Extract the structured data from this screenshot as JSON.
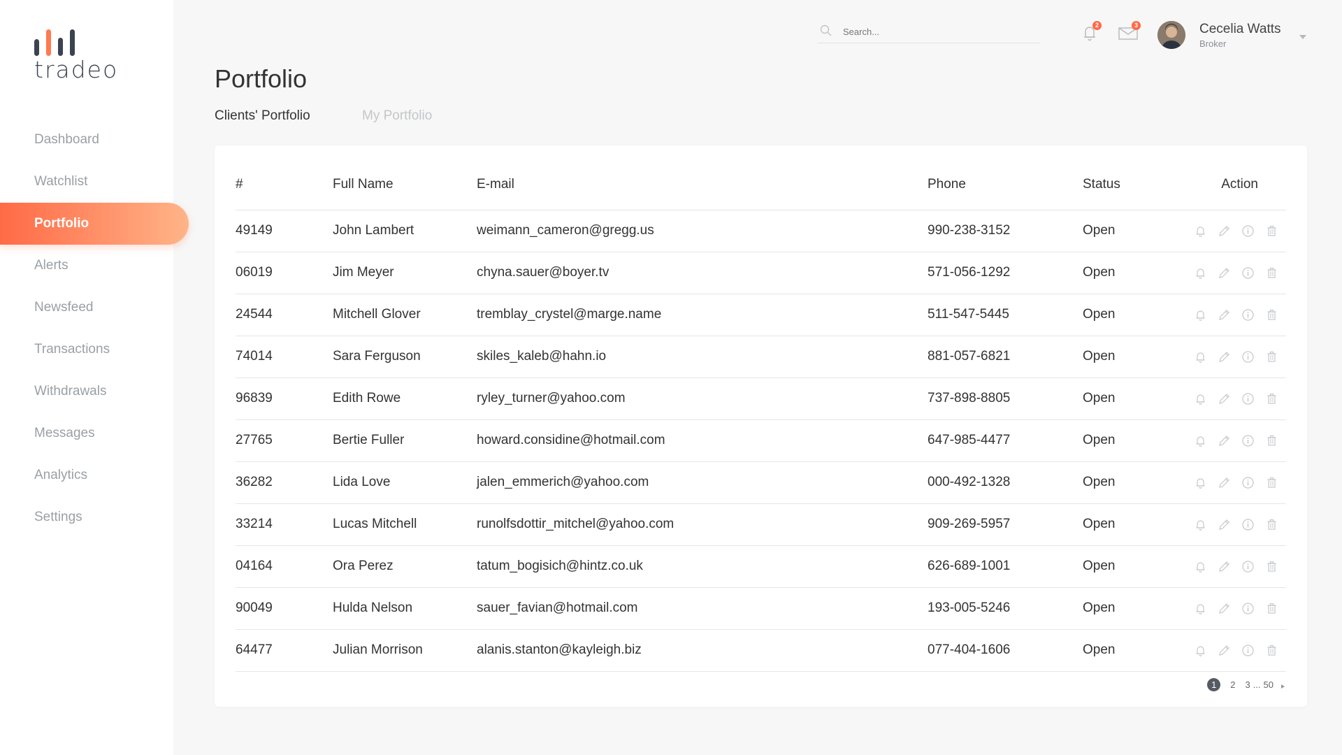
{
  "app": {
    "logo_text": "tradeo"
  },
  "colors": {
    "accent_start": "#ff6a46",
    "accent_end": "#ffb488",
    "status_open": "#7ed321"
  },
  "sidebar": {
    "items": [
      {
        "label": "Dashboard"
      },
      {
        "label": "Watchlist"
      },
      {
        "label": "Portfolio",
        "active": true
      },
      {
        "label": "Alerts"
      },
      {
        "label": "Newsfeed"
      },
      {
        "label": "Transactions"
      },
      {
        "label": "Withdrawals"
      },
      {
        "label": "Messages"
      },
      {
        "label": "Analytics"
      },
      {
        "label": "Settings"
      }
    ]
  },
  "header": {
    "search": {
      "placeholder": "Search..."
    },
    "notifications": {
      "icon": "bell-icon",
      "badge": "2"
    },
    "messages": {
      "icon": "envelope-icon",
      "badge": "3"
    },
    "user": {
      "name": "Cecelia Watts",
      "role": "Broker"
    }
  },
  "main": {
    "title": "Portfolio",
    "tabs": [
      {
        "label": "Clients' Portfolio",
        "active": true
      },
      {
        "label": "My Portfolio"
      }
    ],
    "table": {
      "columns": [
        "#",
        "Full Name",
        "E-mail",
        "Phone",
        "Status",
        "Action"
      ],
      "rows": [
        {
          "id": "49149",
          "name": "John Lambert",
          "email": "weimann_cameron@gregg.us",
          "phone": "990-238-3152",
          "status": "Open"
        },
        {
          "id": "06019",
          "name": "Jim Meyer",
          "email": "chyna.sauer@boyer.tv",
          "phone": "571-056-1292",
          "status": "Open"
        },
        {
          "id": "24544",
          "name": "Mitchell Glover",
          "email": "tremblay_crystel@marge.name",
          "phone": "511-547-5445",
          "status": "Open"
        },
        {
          "id": "74014",
          "name": "Sara Ferguson",
          "email": "skiles_kaleb@hahn.io",
          "phone": "881-057-6821",
          "status": "Open"
        },
        {
          "id": "96839",
          "name": "Edith Rowe",
          "email": "ryley_turner@yahoo.com",
          "phone": "737-898-8805",
          "status": "Open"
        },
        {
          "id": "27765",
          "name": "Bertie Fuller",
          "email": "howard.considine@hotmail.com",
          "phone": "647-985-4477",
          "status": "Open"
        },
        {
          "id": "36282",
          "name": "Lida Love",
          "email": "jalen_emmerich@yahoo.com",
          "phone": "000-492-1328",
          "status": "Open"
        },
        {
          "id": "33214",
          "name": "Lucas Mitchell",
          "email": "runolfsdottir_mitchel@yahoo.com",
          "phone": "909-269-5957",
          "status": "Open"
        },
        {
          "id": "04164",
          "name": "Ora Perez",
          "email": "tatum_bogisich@hintz.co.uk",
          "phone": "626-689-1001",
          "status": "Open"
        },
        {
          "id": "90049",
          "name": "Hulda Nelson",
          "email": "sauer_favian@hotmail.com",
          "phone": "193-005-5246",
          "status": "Open"
        },
        {
          "id": "64477",
          "name": "Julian Morrison",
          "email": "alanis.stanton@kayleigh.biz",
          "phone": "077-404-1606",
          "status": "Open"
        }
      ],
      "row_actions": [
        "bell-icon",
        "pencil-icon",
        "info-icon",
        "trash-icon"
      ]
    },
    "pagination": {
      "current": "1",
      "pages": [
        "2",
        "3"
      ],
      "ellipsis": "...",
      "last": "50"
    }
  }
}
